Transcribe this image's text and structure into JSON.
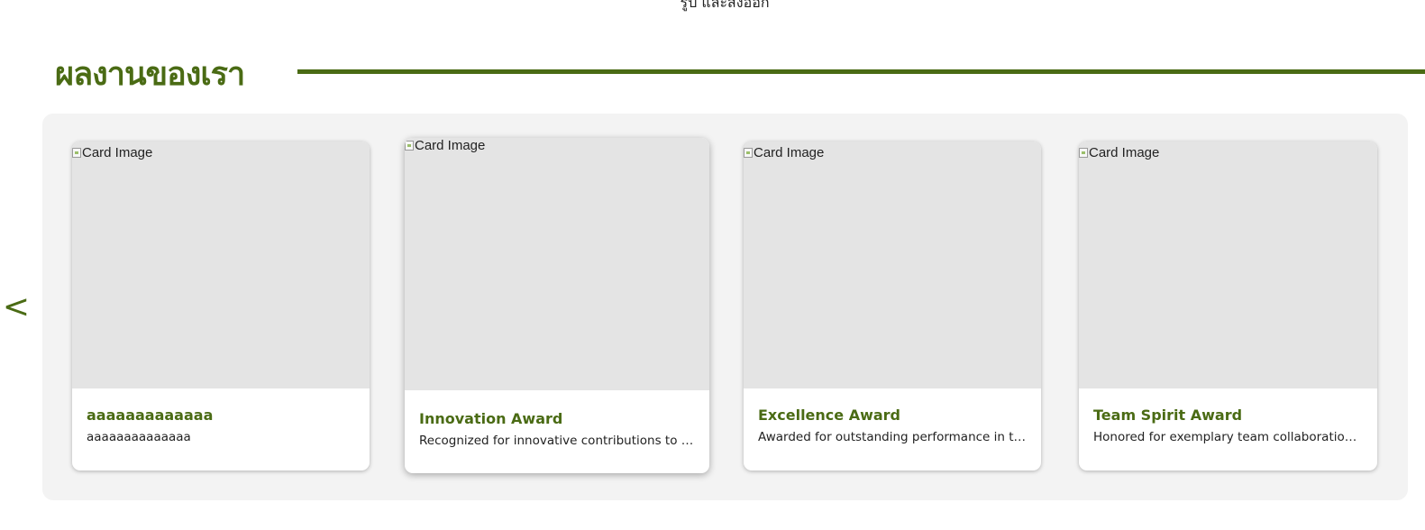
{
  "top_caption": "รูป และส่งออก",
  "section": {
    "title": "ผลงานของเรา"
  },
  "carousel": {
    "prev_label": "<",
    "image_alt": "Card Image",
    "cards": [
      {
        "title": "aaaaaaaaaaaaa",
        "description": "aaaaaaaaaaaaaa"
      },
      {
        "title": "Innovation Award",
        "description": "Recognized for innovative contributions to the field."
      },
      {
        "title": "Excellence Award",
        "description": "Awarded for outstanding performance in the industry."
      },
      {
        "title": "Team Spirit Award",
        "description": "Honored for exemplary team collaboration and support."
      }
    ]
  },
  "colors": {
    "brand_green": "#4a6b14",
    "panel_background": "#f3f3f3",
    "image_placeholder": "#e4e4e4"
  }
}
